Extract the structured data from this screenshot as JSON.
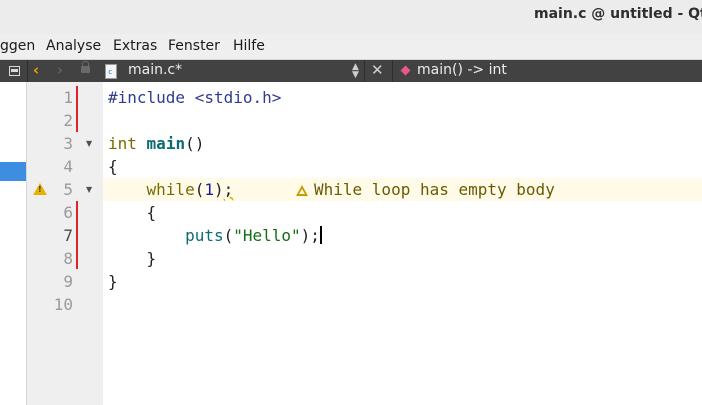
{
  "window": {
    "title": "main.c @ untitled - Qt Cr"
  },
  "menu": [
    "ggen",
    "Analyse",
    "Extras",
    "Fenster",
    "Hilfe"
  ],
  "toolbar": {
    "document": "main.c*",
    "file_icon_letter": "c",
    "symbol": "main() -> int",
    "back_icon": "chevron-left-icon",
    "forward_icon": "chevron-right-icon",
    "close_icon": "close-icon"
  },
  "editor": {
    "line_numbers": [
      "1",
      "2",
      "3",
      "4",
      "5",
      "6",
      "7",
      "8",
      "9",
      "10"
    ],
    "current_line": 7,
    "code": {
      "l1_directive": "#include",
      "l1_header": " <stdio.h>",
      "l3_type": "int",
      "l3_name": "main",
      "l3_parens": "()",
      "l4": "{",
      "l5_indent": "    ",
      "l5_kw": "while",
      "l5_open": "(",
      "l5_num": "1",
      "l5_close": ")",
      "l5_semi": ";",
      "l6": "    {",
      "l7_indent": "        ",
      "l7_call": "puts",
      "l7_open": "(",
      "l7_str": "\"Hello\"",
      "l7_close": ");",
      "l8": "    }",
      "l9": "}"
    },
    "warning": "While loop has empty body"
  },
  "colors": {
    "change_marker": "#e0242a",
    "warning": "#e6b300",
    "selection": "#3d8ee0"
  }
}
